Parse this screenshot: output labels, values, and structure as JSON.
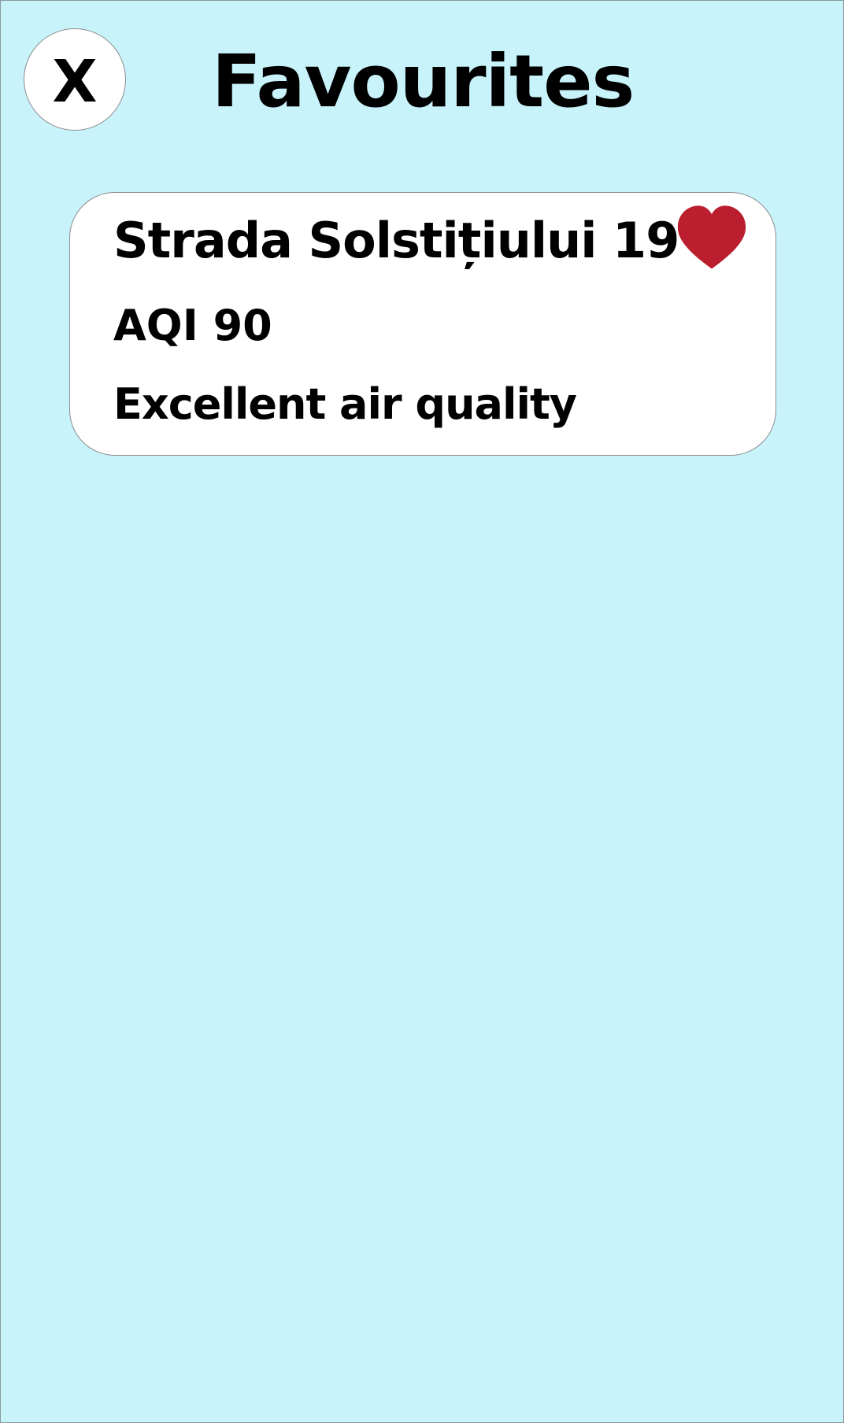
{
  "header": {
    "close_label": "X",
    "title": "Favourites"
  },
  "favourites": [
    {
      "location": "Strada Solstițiului 19",
      "aqi": "AQI 90",
      "status": "Excellent air quality",
      "icon": "heart-icon",
      "favourited": true
    }
  ],
  "colors": {
    "background": "#c8f3fa",
    "card": "#ffffff",
    "heart": "#bb1e2e",
    "text": "#000000"
  }
}
